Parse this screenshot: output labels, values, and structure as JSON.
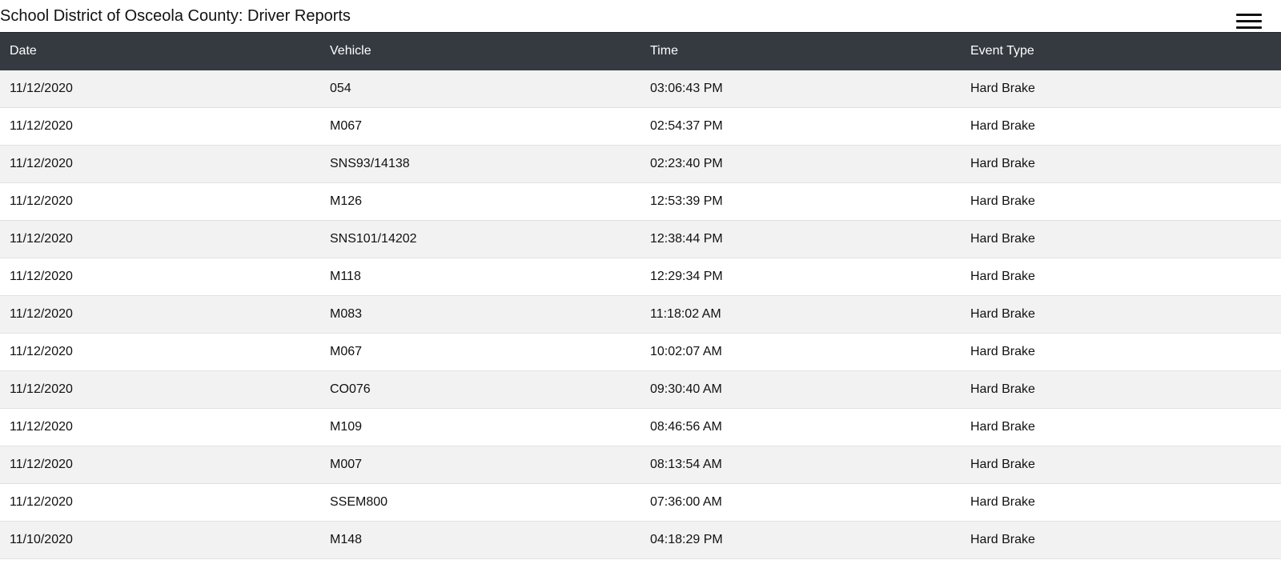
{
  "header": {
    "title": "School District of Osceola County: Driver Reports",
    "menu_icon": "hamburger-menu-icon"
  },
  "table": {
    "columns": [
      "Date",
      "Vehicle",
      "Time",
      "Event Type"
    ],
    "rows": [
      [
        "11/12/2020",
        "054",
        "03:06:43 PM",
        "Hard Brake"
      ],
      [
        "11/12/2020",
        "M067",
        "02:54:37 PM",
        "Hard Brake"
      ],
      [
        "11/12/2020",
        "SNS93/14138",
        "02:23:40 PM",
        "Hard Brake"
      ],
      [
        "11/12/2020",
        "M126",
        "12:53:39 PM",
        "Hard Brake"
      ],
      [
        "11/12/2020",
        "SNS101/14202",
        "12:38:44 PM",
        "Hard Brake"
      ],
      [
        "11/12/2020",
        "M118",
        "12:29:34 PM",
        "Hard Brake"
      ],
      [
        "11/12/2020",
        "M083",
        "11:18:02 AM",
        "Hard Brake"
      ],
      [
        "11/12/2020",
        "M067",
        "10:02:07 AM",
        "Hard Brake"
      ],
      [
        "11/12/2020",
        "CO076",
        "09:30:40 AM",
        "Hard Brake"
      ],
      [
        "11/12/2020",
        "M109",
        "08:46:56 AM",
        "Hard Brake"
      ],
      [
        "11/12/2020",
        "M007",
        "08:13:54 AM",
        "Hard Brake"
      ],
      [
        "11/12/2020",
        "SSEM800",
        "07:36:00 AM",
        "Hard Brake"
      ],
      [
        "11/10/2020",
        "M148",
        "04:18:29 PM",
        "Hard Brake"
      ]
    ]
  },
  "colors": {
    "header_bg": "#343a40",
    "row_stripe": "#f2f2f2",
    "row_plain": "#ffffff"
  }
}
